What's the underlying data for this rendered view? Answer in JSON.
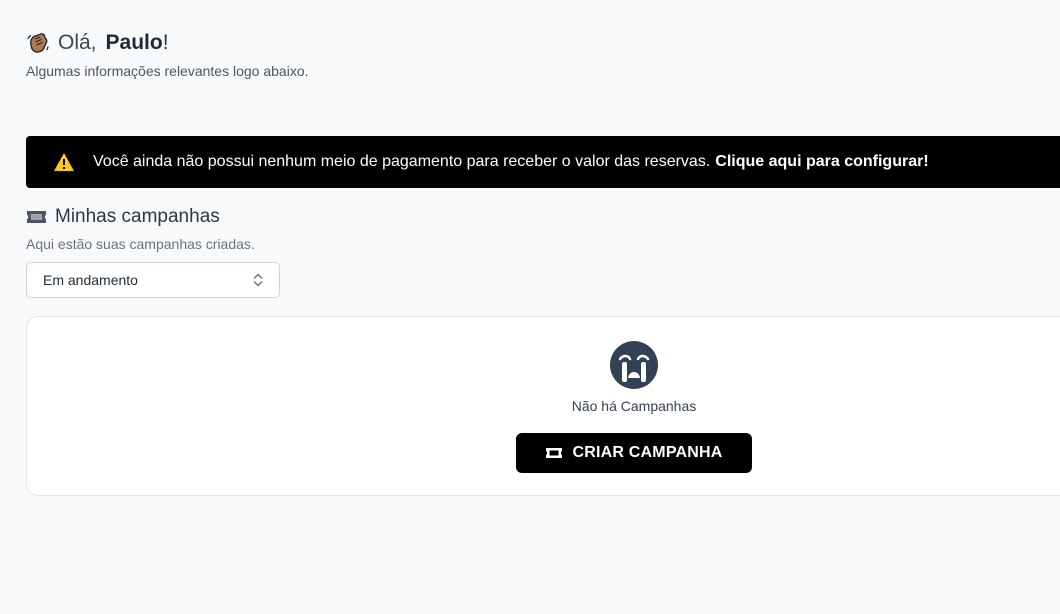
{
  "greeting": {
    "icon": "waving-hand-icon",
    "hello": "Olá,",
    "name": "Paulo",
    "punct": "!",
    "subtitle": "Algumas informações relevantes logo abaixo."
  },
  "alert": {
    "icon": "warning-icon",
    "message": "Você ainda não possui nenhum meio de pagamento para receber o valor das reservas.",
    "link_text": "Clique aqui para configurar!",
    "background": "#000000",
    "icon_color": "#facc15"
  },
  "campaigns": {
    "icon": "ticket-icon",
    "title": "Minhas campanhas",
    "subtitle": "Aqui estão suas campanhas criadas.",
    "filter": {
      "selected": "Em andamento",
      "icon": "chevron-up-down-icon"
    },
    "empty_state": {
      "icon": "crying-face-icon",
      "text": "Não há Campanhas",
      "button_label": "CRIAR CAMPANHA",
      "button_icon": "ticket-icon"
    }
  }
}
